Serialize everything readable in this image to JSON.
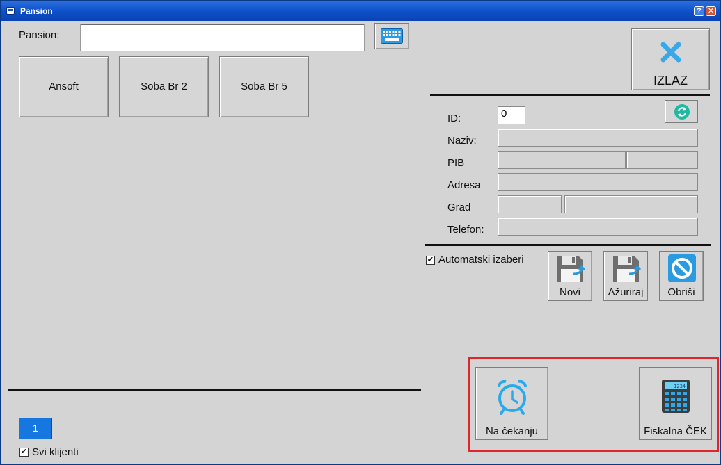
{
  "window": {
    "title": "Pansion",
    "help_label": "?",
    "close_label": "✕"
  },
  "search": {
    "label": "Pansion:",
    "value": ""
  },
  "rooms": [
    {
      "label": "Ansoft"
    },
    {
      "label": "Soba Br 2"
    },
    {
      "label": "Soba Br 5"
    }
  ],
  "exit_button": {
    "label": "IZLAZ",
    "icon": "close-x-icon"
  },
  "client_form": {
    "id_label": "ID:",
    "id_value": "0",
    "naziv_label": "Naziv:",
    "naziv_value": "",
    "pib_label": "PIB",
    "pib_value": "",
    "pib_extra_value": "",
    "adresa_label": "Adresa",
    "adresa_value": "",
    "grad_label": "Grad",
    "grad_zip_value": "",
    "grad_name_value": "",
    "telefon_label": "Telefon:",
    "telefon_value": ""
  },
  "auto_select": {
    "label": "Automatski izaberi",
    "checked": true,
    "mark": "✔"
  },
  "actions": {
    "novi_label": "Novi",
    "azuriraj_label": "Ažuriraj",
    "obrisi_label": "Obriši"
  },
  "bottom_actions": {
    "na_cekanju_label": "Na čekanju",
    "fiskalna_label": "Fiskalna ČEK",
    "calculator_display": "1234"
  },
  "pager": {
    "current_page": "1"
  },
  "all_clients": {
    "label": "Svi klijenti",
    "checked": true,
    "mark": "✔"
  },
  "colors": {
    "accent_blue": "#1677e0",
    "title_blue": "#0e4fc7",
    "exit_icon_blue": "#3aa7e6",
    "refresh_green": "#1fb8a0",
    "highlight_red": "#e0262b"
  }
}
